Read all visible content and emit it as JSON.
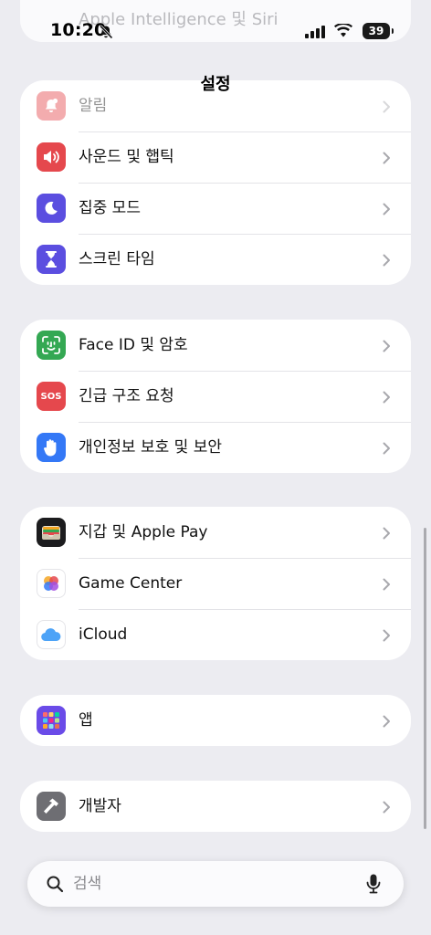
{
  "status_bar": {
    "time": "10:20",
    "battery": "39",
    "ghost_row_label": "Apple Intelligence 및 Siri"
  },
  "nav": {
    "title": "설정"
  },
  "groups": [
    {
      "rows": [
        {
          "label": "알림",
          "icon": "bell-icon",
          "color": "#e5484d"
        },
        {
          "label": "사운드 및 햅틱",
          "icon": "speaker-icon",
          "color": "#e5484d"
        },
        {
          "label": "집중 모드",
          "icon": "moon-icon",
          "color": "#5b4ee0"
        },
        {
          "label": "스크린 타임",
          "icon": "hourglass-icon",
          "color": "#5b4ee0"
        }
      ]
    },
    {
      "rows": [
        {
          "label": "Face ID 및 암호",
          "icon": "face-id-icon",
          "color": "#34a853"
        },
        {
          "label": "긴급 구조 요청",
          "icon": "sos-icon",
          "icon_text": "SOS",
          "color": "#e5484d"
        },
        {
          "label": "개인정보 보호 및 보안",
          "icon": "hand-icon",
          "color": "#3478f6"
        }
      ]
    },
    {
      "rows": [
        {
          "label": "지갑 및 Apple Pay",
          "icon": "wallet-icon",
          "color": "#1c1c1e"
        },
        {
          "label": "Game Center",
          "icon": "game-center-icon",
          "color": "#ffffff"
        },
        {
          "label": "iCloud",
          "icon": "cloud-icon",
          "color": "#ffffff"
        }
      ]
    },
    {
      "rows": [
        {
          "label": "앱",
          "icon": "apps-grid-icon",
          "color": "#6a4be8"
        }
      ]
    },
    {
      "rows": [
        {
          "label": "개발자",
          "icon": "hammer-icon",
          "color": "#6e6e73"
        }
      ]
    }
  ],
  "search": {
    "placeholder": "검색"
  }
}
